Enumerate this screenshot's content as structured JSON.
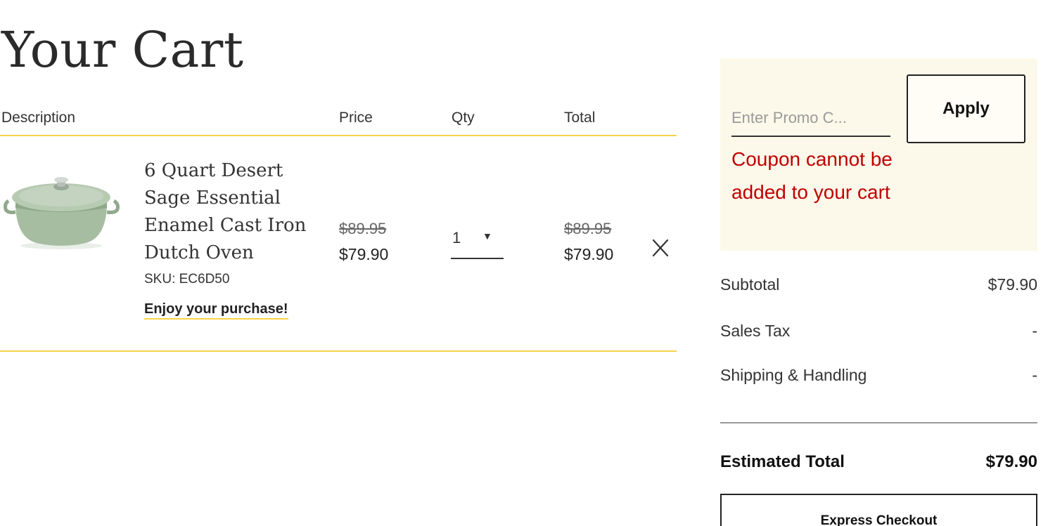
{
  "page": {
    "title": "Your Cart"
  },
  "cart": {
    "headers": {
      "description": "Description",
      "price": "Price",
      "qty": "Qty",
      "total": "Total"
    },
    "items": [
      {
        "name": "6 Quart Desert Sage Essential Enamel Cast Iron Dutch Oven",
        "sku": "SKU: EC6D50",
        "promo_message": "Enjoy your purchase!",
        "original_price": "$89.95",
        "sale_price": "$79.90",
        "quantity": "1",
        "original_total": "$89.95",
        "sale_total": "$79.90",
        "image_color": "#a9bfa5"
      }
    ],
    "accent_color": "#f6d34a"
  },
  "summary": {
    "promo": {
      "placeholder": "Enter Promo C...",
      "value": "",
      "apply_label": "Apply",
      "error": "Coupon cannot be added to your cart",
      "error_color": "#c00000",
      "background": "#fdf9ea"
    },
    "rows": {
      "subtotal_label": "Subtotal",
      "subtotal_value": "$79.90",
      "tax_label": "Sales Tax",
      "tax_value": "-",
      "shipping_label": "Shipping & Handling",
      "shipping_value": "-",
      "estimated_label": "Estimated Total",
      "estimated_value": "$79.90"
    },
    "express_checkout_label": "Express Checkout"
  }
}
